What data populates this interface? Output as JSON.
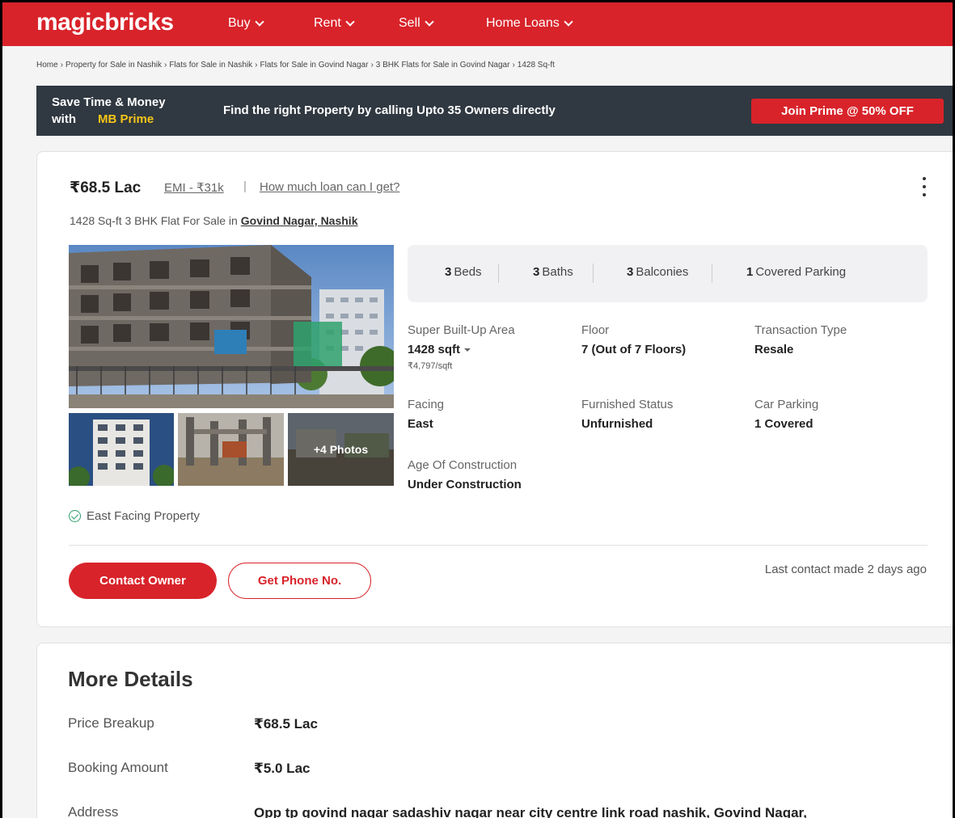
{
  "header": {
    "logo": "magicbricks",
    "nav": [
      {
        "label": "Buy"
      },
      {
        "label": "Rent"
      },
      {
        "label": "Sell"
      },
      {
        "label": "Home Loans"
      }
    ]
  },
  "breadcrumb": [
    "Home",
    "Property for Sale in Nashik",
    "Flats for Sale in Nashik",
    "Flats for Sale in Govind Nagar",
    "3 BHK Flats for Sale in Govind Nagar",
    "1428 Sq-ft"
  ],
  "prime": {
    "line1": "Save Time & Money",
    "line2": "with",
    "brand": "MB Prime",
    "message": "Find the right Property by calling Upto 35 Owners directly",
    "button": "Join Prime @ 50% OFF"
  },
  "listing": {
    "price": "₹68.5 Lac",
    "emi": "EMI - ₹31k",
    "divider": "|",
    "loan_link": "How much loan can I get?",
    "title": "1428 Sq-ft 3 BHK Flat For Sale in",
    "locality": "Govind Nagar, Nashik",
    "more_photos": "+4 Photos",
    "summary": [
      {
        "num": "3",
        "label": "Beds"
      },
      {
        "num": "3",
        "label": "Baths"
      },
      {
        "num": "3",
        "label": "Balconies"
      },
      {
        "num": "1",
        "label": "Covered Parking"
      }
    ],
    "details": {
      "area_label": "Super Built-Up Area",
      "area_value": "1428 sqft",
      "area_rate": "₹4,797/sqft",
      "floor_label": "Floor",
      "floor_value": "7 (Out of 7 Floors)",
      "transaction_label": "Transaction Type",
      "transaction_value": "Resale",
      "facing_label": "Facing",
      "facing_value": "East",
      "furnished_label": "Furnished Status",
      "furnished_value": "Unfurnished",
      "parking_label": "Car Parking",
      "parking_value": "1 Covered",
      "age_label": "Age Of Construction",
      "age_value": "Under Construction"
    },
    "highlight": "East Facing Property",
    "contact_button": "Contact Owner",
    "phone_button": "Get Phone No.",
    "last_contact": "Last contact made 2 days ago"
  },
  "more_details": {
    "title": "More Details",
    "rows": [
      {
        "label": "Price Breakup",
        "value": "₹68.5 Lac"
      },
      {
        "label": "Booking Amount",
        "value": "₹5.0 Lac"
      },
      {
        "label": "Address",
        "value": "Opp tp govind nagar sadashiv nagar near city centre link road nashik, Govind Nagar,"
      }
    ]
  },
  "colors": {
    "brand_red": "#d8232a",
    "prime_bg": "#303841",
    "prime_gold": "#f5c518",
    "check_green": "#2e9d6d"
  }
}
